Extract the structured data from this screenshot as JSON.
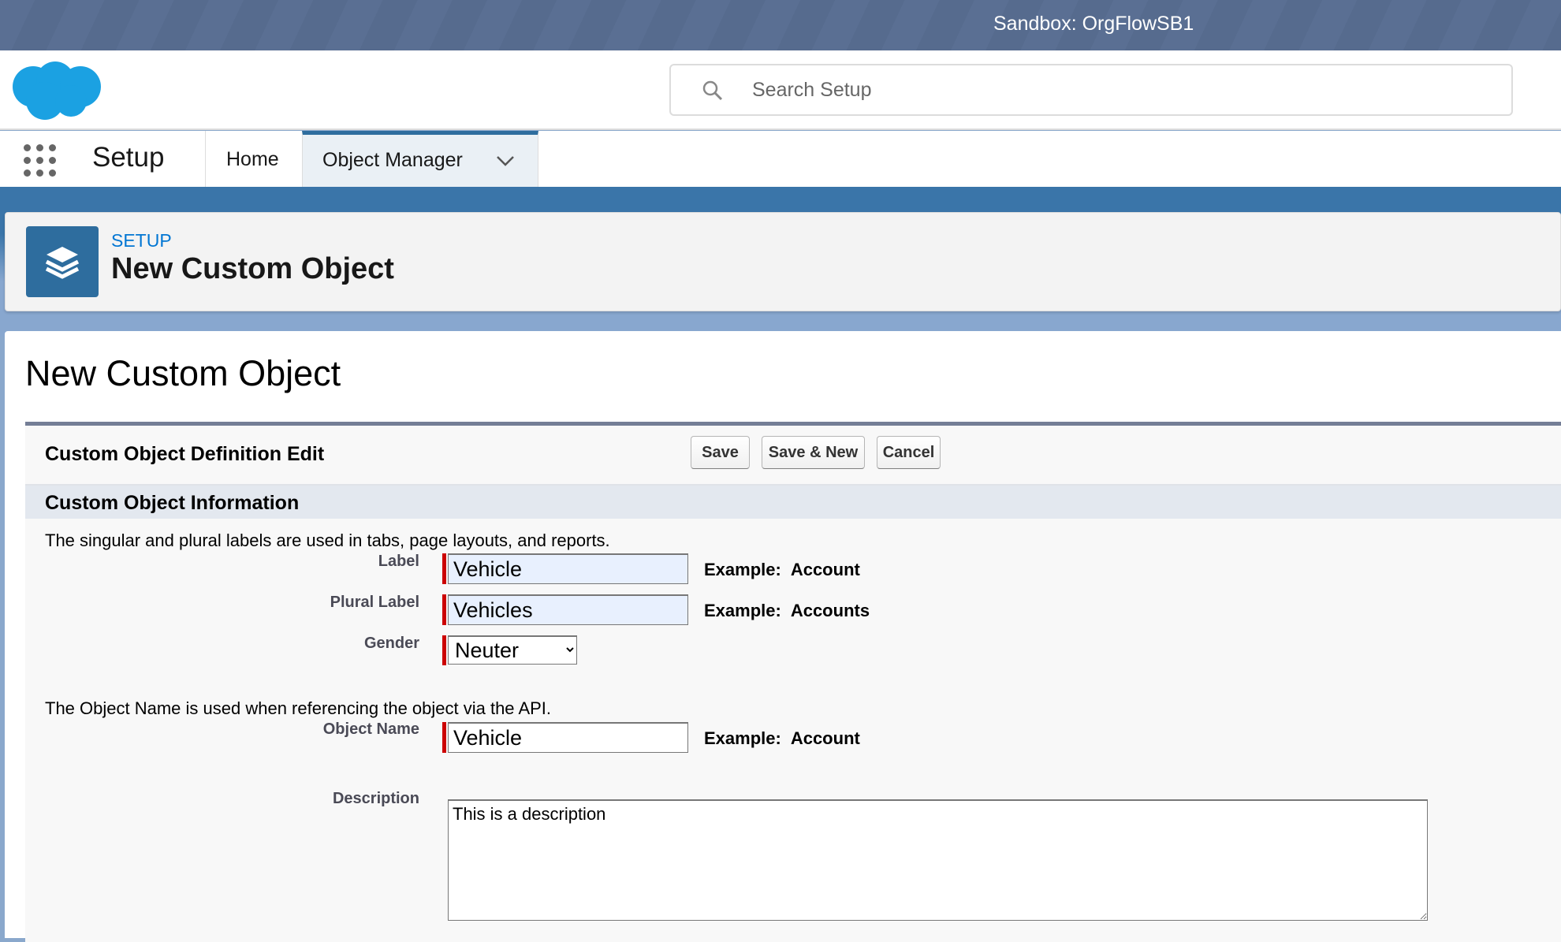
{
  "topbar": {
    "sandbox": "Sandbox: OrgFlowSB1"
  },
  "header": {
    "search_placeholder": "Search Setup",
    "logo": "salesforce-cloud-logo",
    "brand_color": "#1ba1e2"
  },
  "nav": {
    "app_title": "Setup",
    "tabs": [
      {
        "label": "Home"
      },
      {
        "label": "Object Manager",
        "active": true
      }
    ]
  },
  "page_header": {
    "breadcrumb": "SETUP",
    "title": "New Custom Object",
    "icon": "layers-icon"
  },
  "main": {
    "title": "New Custom Object",
    "form": {
      "title": "Custom Object Definition Edit",
      "buttons": {
        "save": "Save",
        "save_new": "Save & New",
        "cancel": "Cancel"
      },
      "section": "Custom Object Information",
      "labels_help": "The singular and plural labels are used in tabs, page layouts, and reports.",
      "api_help": "The Object Name is used when referencing the object via the API.",
      "fields": {
        "label": {
          "label": "Label",
          "value": "Vehicle",
          "example_prefix": "Example:",
          "example": "Account"
        },
        "plural": {
          "label": "Plural Label",
          "value": "Vehicles",
          "example_prefix": "Example:",
          "example": "Accounts"
        },
        "gender": {
          "label": "Gender",
          "value": "Neuter"
        },
        "object_name": {
          "label": "Object Name",
          "value": "Vehicle",
          "example_prefix": "Example:",
          "example": "Account"
        },
        "description": {
          "label": "Description",
          "value": "This is a description"
        }
      }
    }
  }
}
